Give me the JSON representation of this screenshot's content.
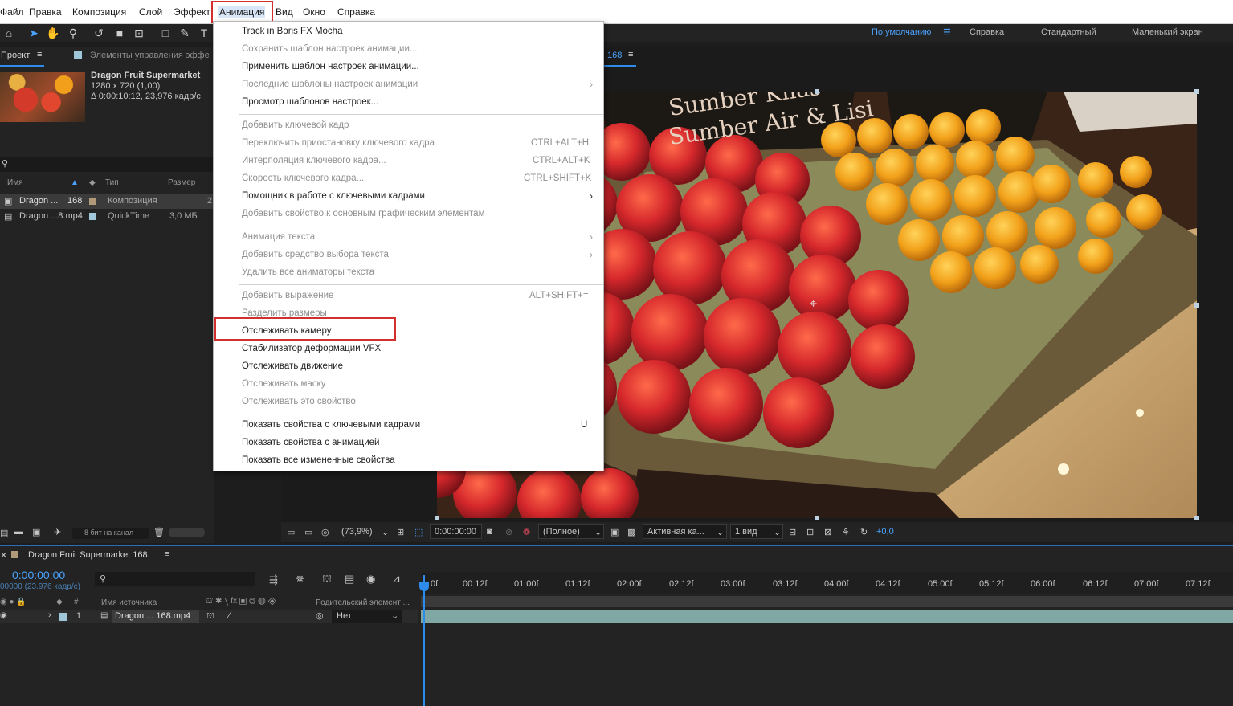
{
  "menubar": {
    "items": [
      "Файл",
      "Правка",
      "Композиция",
      "Слой",
      "Эффект",
      "Анимация",
      "Вид",
      "Окно",
      "Справка"
    ]
  },
  "workspaces": {
    "default": "По умолчанию",
    "help": "Справка",
    "standard": "Стандартный",
    "small": "Маленький экран"
  },
  "project": {
    "tab": "Проект",
    "effects_tab": "Элементы управления эффе",
    "comp_name": "Dragon Fruit  Supermarket",
    "comp_res": "1280 x 720 (1,00)",
    "comp_dur": "Δ 0:00:10:12, 23,976 кадр/с",
    "col_name": "Имя",
    "col_type": "Тип",
    "col_size": "Размер",
    "rows": [
      {
        "name": "Dragon ...",
        "num": "168",
        "type": "Композиция",
        "size": "2"
      },
      {
        "name": "Dragon ...8.mp4",
        "num": "",
        "type": "QuickTime",
        "size": "3,0 МБ"
      }
    ],
    "bit_depth": "8 бит на канал"
  },
  "viewer": {
    "tab_num": "168",
    "zoom": "(73,9%)",
    "timecode": "0:00:00:00",
    "resolution": "(Полное)",
    "camera": "Активная ка...",
    "views": "1 вид",
    "exposure": "+0,0"
  },
  "timeline": {
    "comp_title": "Dragon Fruit  Supermarket  168",
    "timecode": "0:00:00:00",
    "fps": "00000 (23.976 кадр/с)",
    "col_source": "Имя источника",
    "col_parent": "Родительский элемент ...",
    "layer_index": "1",
    "layer_name": "Dragon ...  168.mp4",
    "parent_value": "Нет",
    "ticks": [
      "0f",
      "00:12f",
      "01:00f",
      "01:12f",
      "02:00f",
      "02:12f",
      "03:00f",
      "03:12f",
      "04:00f",
      "04:12f",
      "05:00f",
      "05:12f",
      "06:00f",
      "06:12f",
      "07:00f",
      "07:12f"
    ]
  },
  "menu": {
    "items": [
      {
        "label": "Track in Boris FX Mocha",
        "enabled": true
      },
      {
        "label": "Сохранить шаблон настроек анимации...",
        "enabled": false
      },
      {
        "label": "Применить шаблон настроек анимации...",
        "enabled": true
      },
      {
        "label": "Последние шаблоны настроек анимации",
        "enabled": false
      },
      {
        "label": "Просмотр шаблонов настроек...",
        "enabled": true
      },
      {
        "label": "Добавить ключевой кадр",
        "enabled": false
      },
      {
        "label": "Переключить приостановку ключевого кадра",
        "enabled": false,
        "shortcut": "CTRL+ALT+H"
      },
      {
        "label": "Интерполяция ключевого кадра...",
        "enabled": false,
        "shortcut": "CTRL+ALT+K"
      },
      {
        "label": "Скорость ключевого кадра...",
        "enabled": false,
        "shortcut": "CTRL+SHIFT+K"
      },
      {
        "label": "Помощник в работе с ключевыми кадрами",
        "enabled": true
      },
      {
        "label": "Добавить свойство к основным графическим элементам",
        "enabled": false
      },
      {
        "label": "Анимация текста",
        "enabled": false
      },
      {
        "label": "Добавить средство выбора текста",
        "enabled": false
      },
      {
        "label": "Удалить все аниматоры текста",
        "enabled": false
      },
      {
        "label": "Добавить выражение",
        "enabled": false,
        "shortcut": "ALT+SHIFT+="
      },
      {
        "label": "Разделить размеры",
        "enabled": false
      },
      {
        "label": "Отслеживать камеру",
        "enabled": true
      },
      {
        "label": "Стабилизатор деформации VFX",
        "enabled": true
      },
      {
        "label": "Отслеживать движение",
        "enabled": true
      },
      {
        "label": "Отслеживать маску",
        "enabled": false
      },
      {
        "label": "Отслеживать это свойство",
        "enabled": false
      },
      {
        "label": "Показать свойства с ключевыми кадрами",
        "enabled": true,
        "shortcut": "U"
      },
      {
        "label": "Показать свойства с анимацией",
        "enabled": true
      },
      {
        "label": "Показать все измененные свойства",
        "enabled": true
      }
    ]
  },
  "footage_signs": {
    "line1": "Sumber Khas",
    "line2": "Sumber Air & Lisi"
  },
  "colors": {
    "accent": "#2d8ceb",
    "highlight": "#d32f2f",
    "menu_bg": "#ffffff",
    "panel_bg": "#232323"
  }
}
